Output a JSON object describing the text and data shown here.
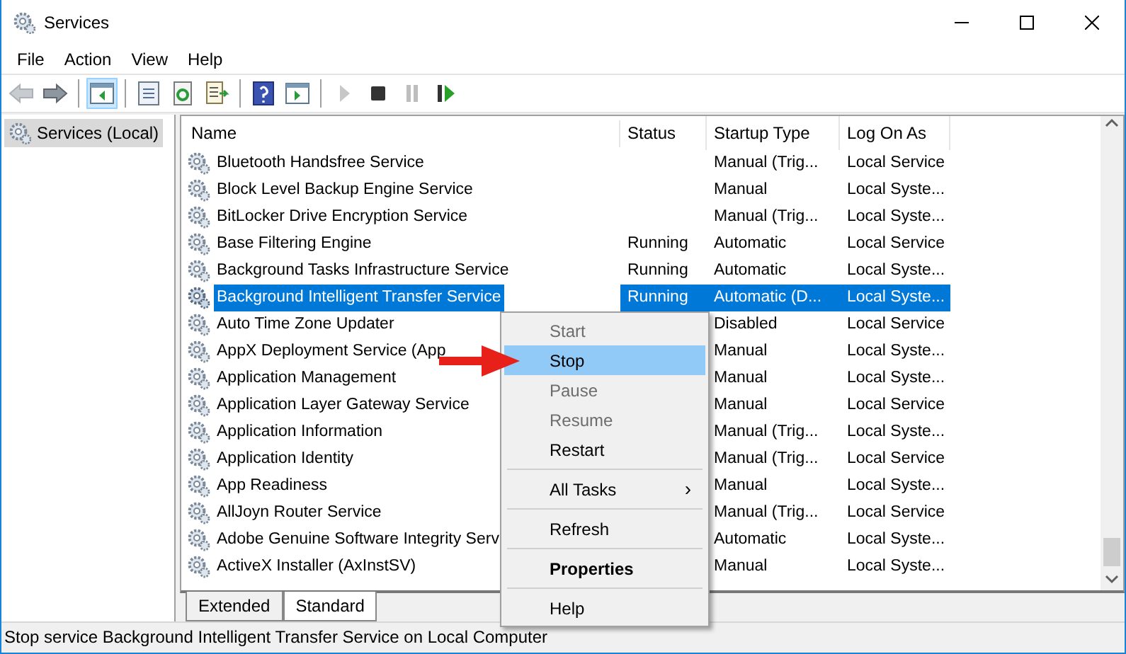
{
  "window": {
    "title": "Services"
  },
  "menu_bar": [
    "File",
    "Action",
    "View",
    "Help"
  ],
  "toolbar": [
    {
      "kind": "button",
      "disabled": true,
      "selected": false
    },
    {
      "kind": "button",
      "disabled": false,
      "selected": false
    },
    {
      "kind": "separator"
    },
    {
      "kind": "button",
      "disabled": false,
      "selected": true
    },
    {
      "kind": "separator"
    },
    {
      "kind": "button",
      "disabled": false,
      "selected": false
    },
    {
      "kind": "button",
      "disabled": false,
      "selected": false
    },
    {
      "kind": "button",
      "disabled": false,
      "selected": false
    },
    {
      "kind": "separator"
    },
    {
      "kind": "button",
      "disabled": false,
      "selected": false
    },
    {
      "kind": "button",
      "disabled": false,
      "selected": false
    },
    {
      "kind": "separator"
    },
    {
      "kind": "button",
      "disabled": true,
      "selected": false
    },
    {
      "kind": "button",
      "disabled": false,
      "selected": false
    },
    {
      "kind": "button",
      "disabled": true,
      "selected": false
    },
    {
      "kind": "button",
      "disabled": false,
      "selected": false
    }
  ],
  "tree": {
    "label": "Services (Local)",
    "selected": true
  },
  "table": {
    "columns": [
      "Name",
      "Status",
      "Startup Type",
      "Log On As"
    ],
    "rows": [
      {
        "name": "Bluetooth Handsfree Service",
        "startup": "Manual (Trig...",
        "logon": "Local Service",
        "selected": false
      },
      {
        "name": "Block Level Backup Engine Service",
        "startup": "Manual",
        "logon": "Local Syste...",
        "selected": false
      },
      {
        "name": "BitLocker Drive Encryption Service",
        "startup": "Manual (Trig...",
        "logon": "Local Syste...",
        "selected": false
      },
      {
        "name": "Base Filtering Engine",
        "status": "Running",
        "startup": "Automatic",
        "logon": "Local Service",
        "selected": false
      },
      {
        "name": "Background Tasks Infrastructure Service",
        "status": "Running",
        "startup": "Automatic",
        "logon": "Local Syste...",
        "selected": false
      },
      {
        "name": "Background Intelligent Transfer Service",
        "status": "Running",
        "startup": "Automatic (D...",
        "logon": "Local Syste...",
        "selected": true
      },
      {
        "name": "Auto Time Zone Updater",
        "startup": "Disabled",
        "logon": "Local Service",
        "selected": false
      },
      {
        "name": "AppX Deployment Service (App",
        "startup": "Manual",
        "logon": "Local Syste...",
        "selected": false
      },
      {
        "name": "Application Management",
        "startup": "Manual",
        "logon": "Local Syste...",
        "selected": false
      },
      {
        "name": "Application Layer Gateway Service",
        "startup": "Manual",
        "logon": "Local Service",
        "selected": false
      },
      {
        "name": "Application Information",
        "startup": "Manual (Trig...",
        "logon": "Local Syste...",
        "selected": false
      },
      {
        "name": "Application Identity",
        "startup": "Manual (Trig...",
        "logon": "Local Service",
        "selected": false
      },
      {
        "name": "App Readiness",
        "startup": "Manual",
        "logon": "Local Syste...",
        "selected": false
      },
      {
        "name": "AllJoyn Router Service",
        "startup": "Manual (Trig...",
        "logon": "Local Service",
        "selected": false
      },
      {
        "name": "Adobe Genuine Software Integrity Serv",
        "startup": "Automatic",
        "logon": "Local Syste...",
        "selected": false
      },
      {
        "name": "ActiveX Installer (AxInstSV)",
        "startup": "Manual",
        "logon": "Local Syste...",
        "selected": false
      }
    ]
  },
  "tabs": [
    {
      "label": "Extended",
      "selected": false
    },
    {
      "label": "Standard",
      "selected": true
    }
  ],
  "context_menu": [
    {
      "kind": "item",
      "label": "Start",
      "disabled": true,
      "selected": false
    },
    {
      "kind": "item",
      "label": "Stop",
      "disabled": false,
      "selected": true
    },
    {
      "kind": "item",
      "label": "Pause",
      "disabled": true,
      "selected": false
    },
    {
      "kind": "item",
      "label": "Resume",
      "disabled": true,
      "selected": false
    },
    {
      "kind": "item",
      "label": "Restart",
      "disabled": false,
      "selected": false
    },
    {
      "kind": "separator"
    },
    {
      "kind": "submenu",
      "label": "All Tasks",
      "arrow": "›",
      "disabled": false,
      "selected": false
    },
    {
      "kind": "separator"
    },
    {
      "kind": "item",
      "label": "Refresh",
      "disabled": false,
      "selected": false
    },
    {
      "kind": "separator"
    },
    {
      "kind": "item",
      "label": "Properties",
      "disabled": false,
      "selected": false,
      "default": true
    },
    {
      "kind": "separator"
    },
    {
      "kind": "item",
      "label": "Help",
      "disabled": false,
      "selected": false
    }
  ],
  "status_bar": "Stop service Background Intelligent Transfer Service on Local Computer"
}
